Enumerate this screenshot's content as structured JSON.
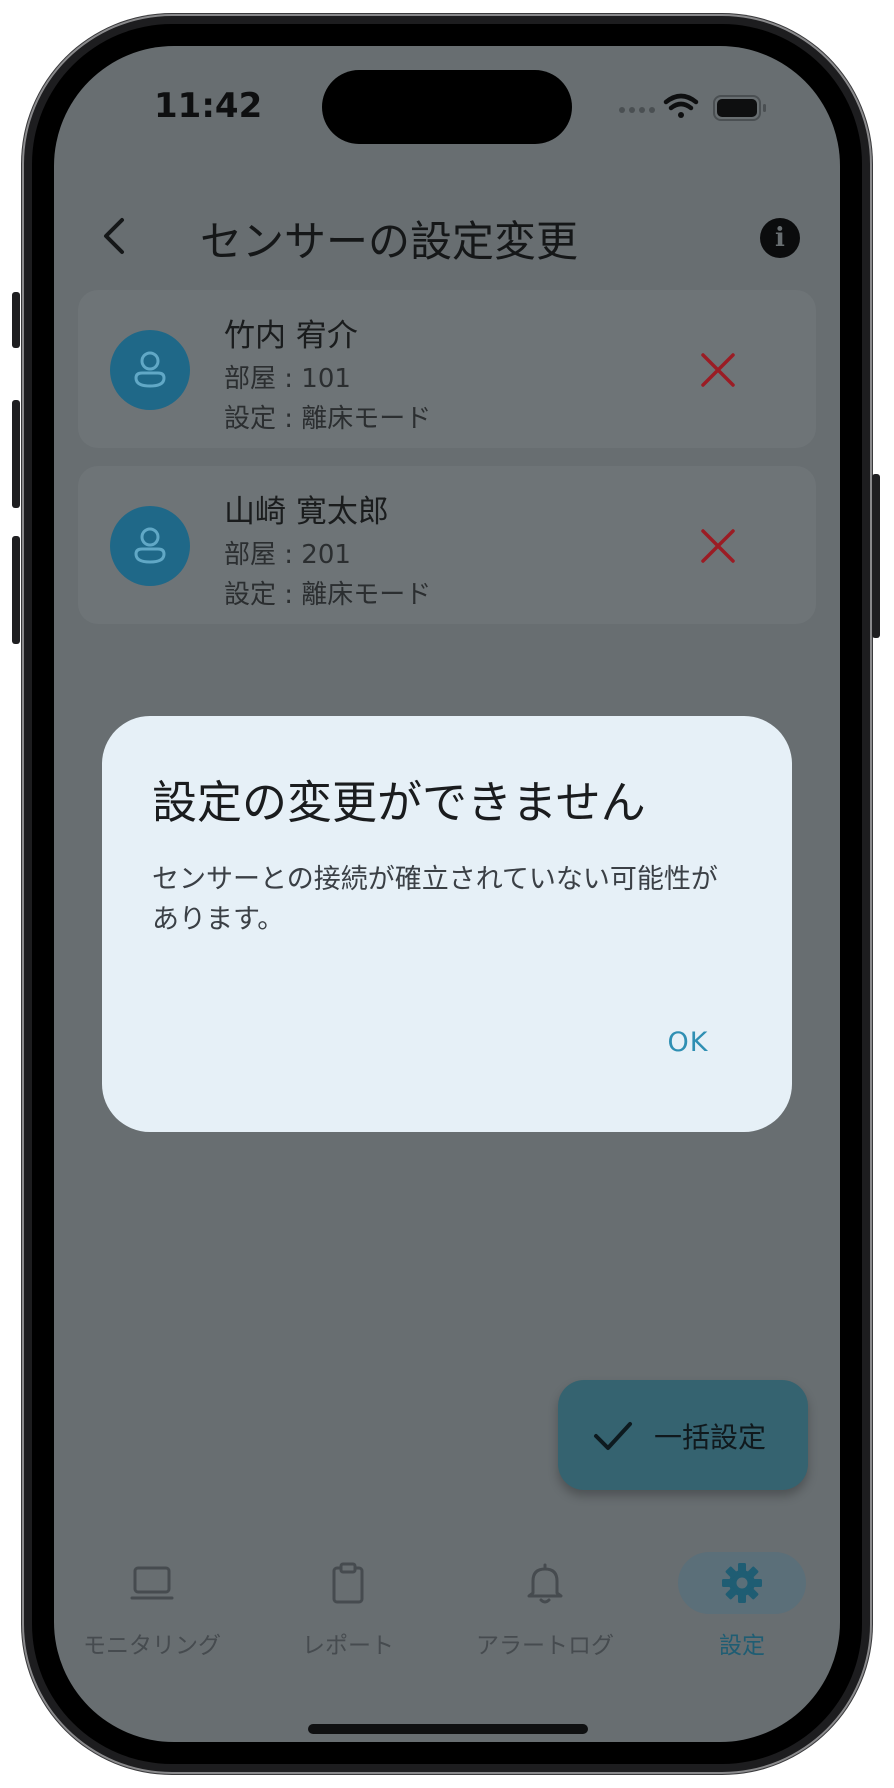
{
  "status_bar": {
    "time": "11:42"
  },
  "app_bar": {
    "title": "センサーの設定変更"
  },
  "residents": [
    {
      "name": "竹内 宥介",
      "room": "部屋 : 101",
      "setting": "設定 : 離床モード"
    },
    {
      "name": "山崎 寛太郎",
      "room": "部屋 : 201",
      "setting": "設定 : 離床モード"
    }
  ],
  "dialog": {
    "title": "設定の変更ができません",
    "body": "センサーとの接続が確立されていない可能性があります。",
    "ok_label": "OK"
  },
  "fab": {
    "label": "一括設定"
  },
  "bottom_nav": {
    "items": [
      {
        "label": "モニタリング",
        "icon": "monitor-icon",
        "active": false
      },
      {
        "label": "レポート",
        "icon": "clipboard-icon",
        "active": false
      },
      {
        "label": "アラートログ",
        "icon": "bell-icon",
        "active": false
      },
      {
        "label": "設定",
        "icon": "gear-icon",
        "active": true
      }
    ]
  },
  "colors": {
    "scrim_background": "#686e71",
    "dialog_background": "#e6f0f7",
    "accent": "#2f8fb3",
    "avatar": "#1f6888",
    "remove": "#9b1c24",
    "fab": "#356370"
  }
}
